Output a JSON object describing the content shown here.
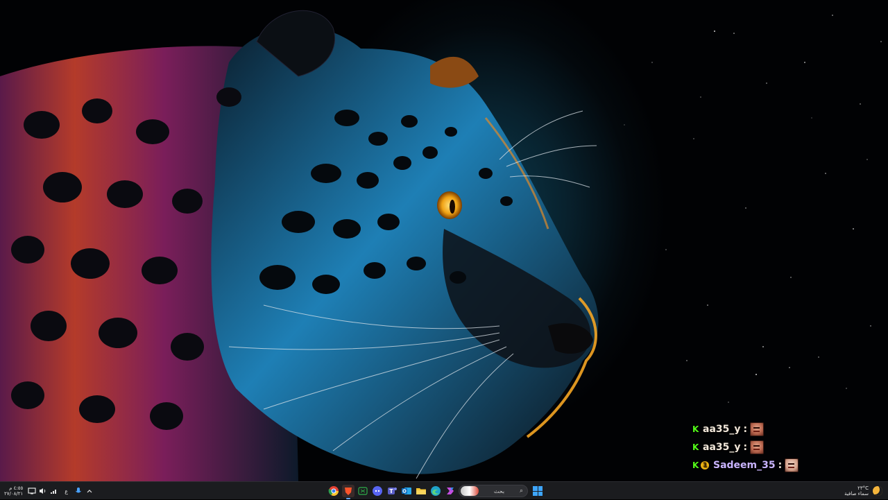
{
  "desktop": {
    "wallpaper_subject": "jaguar profile portrait on starry dark background"
  },
  "chat": {
    "platform_badge": "K",
    "messages": [
      {
        "username": "aa35_y",
        "separator": ":",
        "emote": "face-emote",
        "color": "#f1e7da",
        "has_badge": false
      },
      {
        "username": "aa35_y",
        "separator": ":",
        "emote": "face-emote",
        "color": "#f1e7da",
        "has_badge": false
      },
      {
        "username": "Sadeem_35",
        "separator": ":",
        "emote": "face-emote",
        "color": "#c9b4ff",
        "has_badge": true,
        "badge_text": "1"
      }
    ]
  },
  "taskbar": {
    "clock": {
      "time": "٤:٥٥ م",
      "date": "٢٧/٠٨/٢١"
    },
    "language": "ع",
    "search": {
      "placeholder": "بحث"
    },
    "weather": {
      "temp": "٢٣°C",
      "condition": "سماء صافية"
    },
    "tray_icons": [
      "network-icon",
      "volume-icon",
      "display-icon",
      "microphone-icon",
      "chevron-up-icon"
    ],
    "apps": [
      {
        "name": "chrome-app",
        "glyph": "◉",
        "color": "#e34133"
      },
      {
        "name": "brave-app",
        "glyph": "▼",
        "color": "#fb542b",
        "active": true
      },
      {
        "name": "xbox-app",
        "glyph": "✕",
        "color": "#2f8f3a"
      },
      {
        "name": "discord-app",
        "glyph": "◍",
        "color": "#5865f2"
      },
      {
        "name": "teams-app",
        "glyph": "T",
        "color": "#5b5fc7"
      },
      {
        "name": "outlook-app",
        "glyph": "O",
        "color": "#0f6cbd"
      },
      {
        "name": "file-explorer-app",
        "glyph": "▬",
        "color": "#f2c230"
      },
      {
        "name": "edge-app",
        "glyph": "e",
        "color": "#1fa2c9"
      },
      {
        "name": "copilot-app",
        "glyph": "✦",
        "color": "#c44ee0"
      }
    ]
  }
}
